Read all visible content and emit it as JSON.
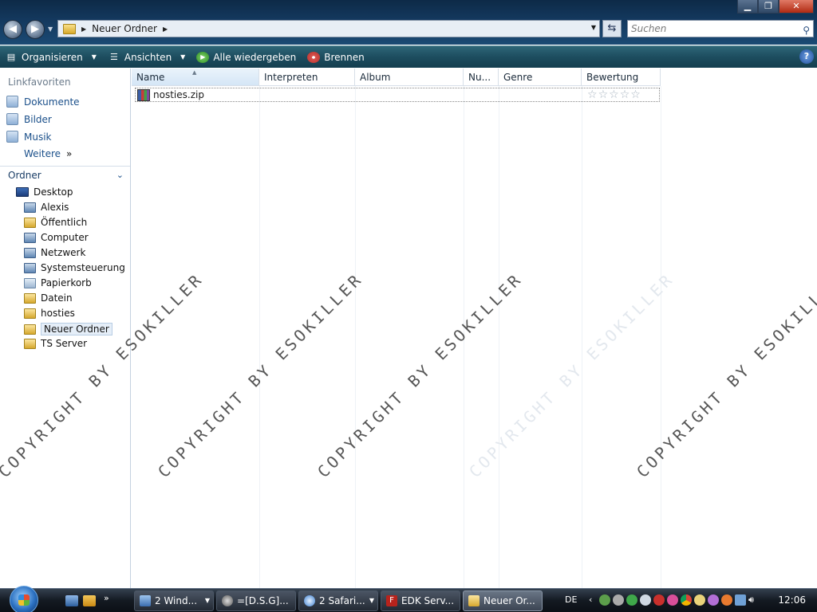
{
  "window": {
    "address_path": "Neuer Ordner",
    "search_placeholder": "Suchen"
  },
  "toolbar": {
    "organize": "Organisieren",
    "views": "Ansichten",
    "play_all": "Alle wiedergeben",
    "burn": "Brennen"
  },
  "nav": {
    "favorites_header": "Linkfavoriten",
    "favorites": [
      "Dokumente",
      "Bilder",
      "Musik"
    ],
    "more": "Weitere",
    "folders_header": "Ordner",
    "tree": {
      "desktop": "Desktop",
      "items": [
        "Alexis",
        "Öffentlich",
        "Computer",
        "Netzwerk",
        "Systemsteuerung",
        "Papierkorb",
        "Datein",
        "hosties",
        "Neuer Ordner",
        "TS Server"
      ]
    }
  },
  "columns": [
    "Name",
    "Interpreten",
    "Album",
    "Nu...",
    "Genre",
    "Bewertung"
  ],
  "files": [
    {
      "name": "nosties.zip",
      "rating": 0
    }
  ],
  "watermark": "COPYRIGHT BY ESOKILLER",
  "taskbar": {
    "buttons": [
      "2 Wind...",
      "=[D.S.G]...",
      "2 Safari...",
      "EDK Serv...",
      "Neuer Or..."
    ],
    "language": "DE",
    "clock": "12:06"
  }
}
